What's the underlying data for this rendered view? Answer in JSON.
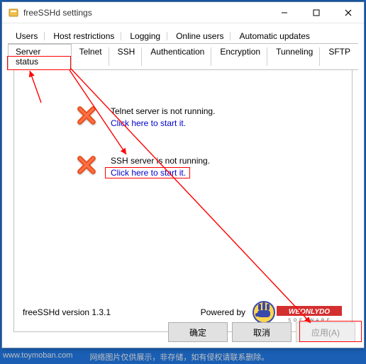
{
  "window": {
    "title": "freeSSHd settings"
  },
  "win_controls": {
    "min": "—",
    "max": "□",
    "close": "✕"
  },
  "tabs_row1": [
    {
      "label": "Users"
    },
    {
      "label": "Host restrictions"
    },
    {
      "label": "Logging"
    },
    {
      "label": "Online users"
    },
    {
      "label": "Automatic updates"
    }
  ],
  "tabs_row2": [
    {
      "label": "Server status",
      "active": true
    },
    {
      "label": "Telnet"
    },
    {
      "label": "SSH"
    },
    {
      "label": "Authentication"
    },
    {
      "label": "Encryption"
    },
    {
      "label": "Tunneling"
    },
    {
      "label": "SFTP"
    }
  ],
  "status": {
    "telnet": {
      "line": "Telnet server is not running.",
      "link": "Click here to start it."
    },
    "ssh": {
      "line": "SSH server is not running.",
      "link": "Click here to start it."
    }
  },
  "footer": {
    "version": "freeSSHd version 1.3.1",
    "powered_by": "Powered by",
    "logo_text_1": "WEONLYDO",
    "logo_text_2": "S O F T W A R E"
  },
  "buttons": {
    "ok": "确定",
    "cancel": "取消",
    "apply": "应用(A)"
  },
  "watermark": {
    "left": "www.toymoban.com",
    "right": "网络图片仅供展示，非存储，如有侵权请联系删除。"
  }
}
